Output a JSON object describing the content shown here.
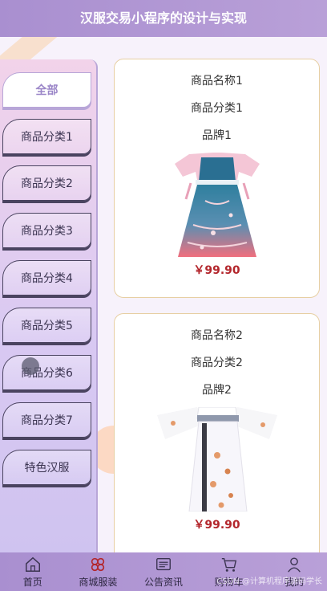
{
  "header": {
    "title": "汉服交易小程序的设计与实现"
  },
  "sidebar": {
    "categories": [
      {
        "label": "全部",
        "active": true
      },
      {
        "label": "商品分类1",
        "active": false
      },
      {
        "label": "商品分类2",
        "active": false
      },
      {
        "label": "商品分类3",
        "active": false
      },
      {
        "label": "商品分类4",
        "active": false
      },
      {
        "label": "商品分类5",
        "active": false
      },
      {
        "label": "商品分类6",
        "active": false
      },
      {
        "label": "商品分类7",
        "active": false
      },
      {
        "label": "特色汉服",
        "active": false
      }
    ]
  },
  "products": [
    {
      "name": "商品名称1",
      "category": "商品分类1",
      "brand": "品牌1",
      "price": "￥99.90",
      "image": "blue-pink-hanfu-dress"
    },
    {
      "name": "商品名称2",
      "category": "商品分类2",
      "brand": "品牌2",
      "price": "￥99.90",
      "image": "white-floral-hanfu-dress"
    }
  ],
  "tabbar": {
    "items": [
      {
        "label": "首页",
        "icon": "home-icon"
      },
      {
        "label": "商城服装",
        "icon": "clover-icon",
        "active": true
      },
      {
        "label": "公告资讯",
        "icon": "news-icon"
      },
      {
        "label": "购物车",
        "icon": "cart-icon"
      },
      {
        "label": "我的",
        "icon": "user-icon"
      }
    ]
  },
  "watermark": "CSDN @计算机程序源码学长",
  "colors": {
    "accent": "#a98fd0",
    "price": "#b3262c",
    "card_border": "#e7cfa3"
  }
}
